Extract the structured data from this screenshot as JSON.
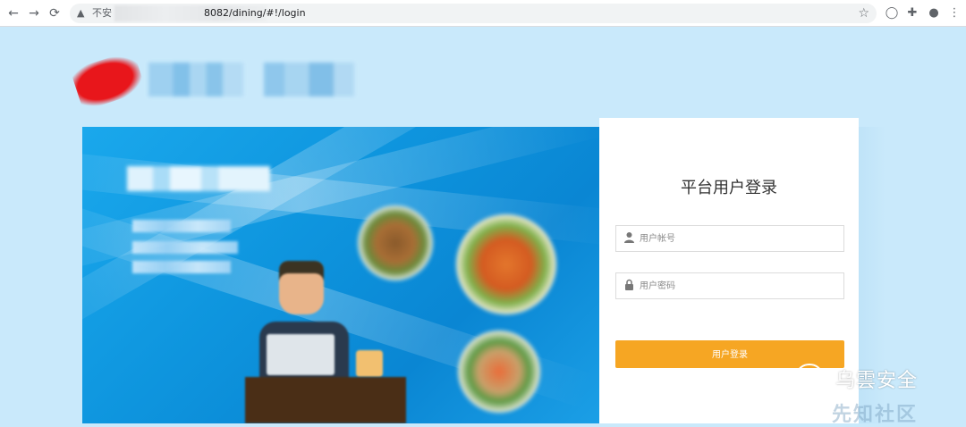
{
  "browser": {
    "back_icon": "arrow-left-icon",
    "forward_icon": "arrow-right-icon",
    "reload_icon": "reload-icon",
    "not_secure_label": "不安",
    "url_visible": "8082/dining/#!/login",
    "star_icon": "star-icon",
    "extension_icons": [
      "circle-icon",
      "puzzle-icon",
      "profile-icon"
    ],
    "menu_icon": "more-vert-icon"
  },
  "login": {
    "title": "平台用户登录",
    "username": {
      "placeholder": "用户帐号",
      "value": ""
    },
    "password": {
      "placeholder": "用户密码",
      "value": ""
    },
    "submit_label": "用户登录"
  },
  "watermark": {
    "text": "乌雲安全",
    "faint_text": "先知社区"
  },
  "colors": {
    "page_bg": "#c9e9fb",
    "banner_blue": "#0e95de",
    "button_orange": "#f6a623"
  }
}
